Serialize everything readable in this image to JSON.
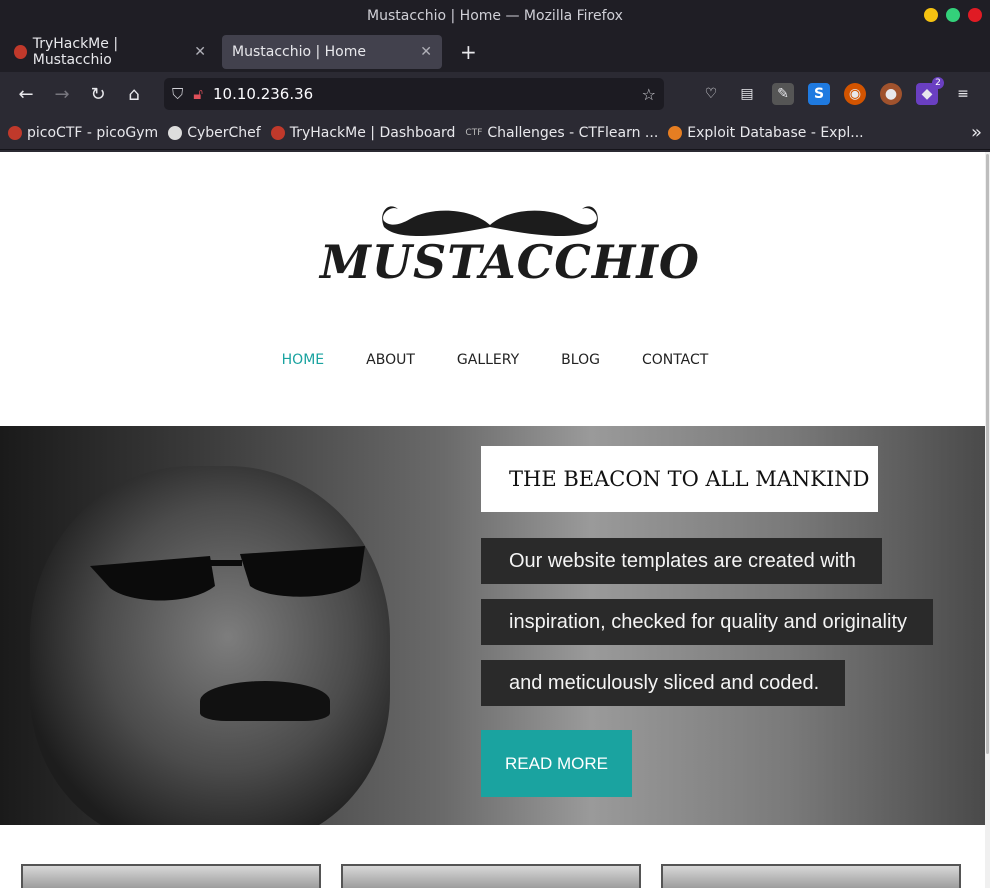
{
  "window": {
    "title": "Mustacchio | Home — Mozilla Firefox"
  },
  "tabs": [
    {
      "label": "TryHackMe | Mustacchio"
    },
    {
      "label": "Mustacchio | Home"
    }
  ],
  "url": "10.10.236.36",
  "extensions": {
    "badge_count": "2"
  },
  "bookmarks": [
    {
      "label": "picoCTF - picoGym"
    },
    {
      "label": "CyberChef"
    },
    {
      "label": "TryHackMe | Dashboard"
    },
    {
      "label": "Challenges - CTFlearn ..."
    },
    {
      "label": "Exploit Database - Expl..."
    }
  ],
  "site": {
    "logo_text": "MUSTACCHIO",
    "menu": [
      {
        "label": "HOME"
      },
      {
        "label": "ABOUT"
      },
      {
        "label": "GALLERY"
      },
      {
        "label": "BLOG"
      },
      {
        "label": "CONTACT"
      }
    ],
    "hero": {
      "headline": "THE BEACON TO ALL MANKIND",
      "lines": [
        "Our website templates are created with",
        "inspiration, checked for quality and originality",
        "and meticulously sliced and coded."
      ],
      "button": "READ MORE"
    }
  },
  "colors": {
    "accent": "#1aa3a0"
  }
}
